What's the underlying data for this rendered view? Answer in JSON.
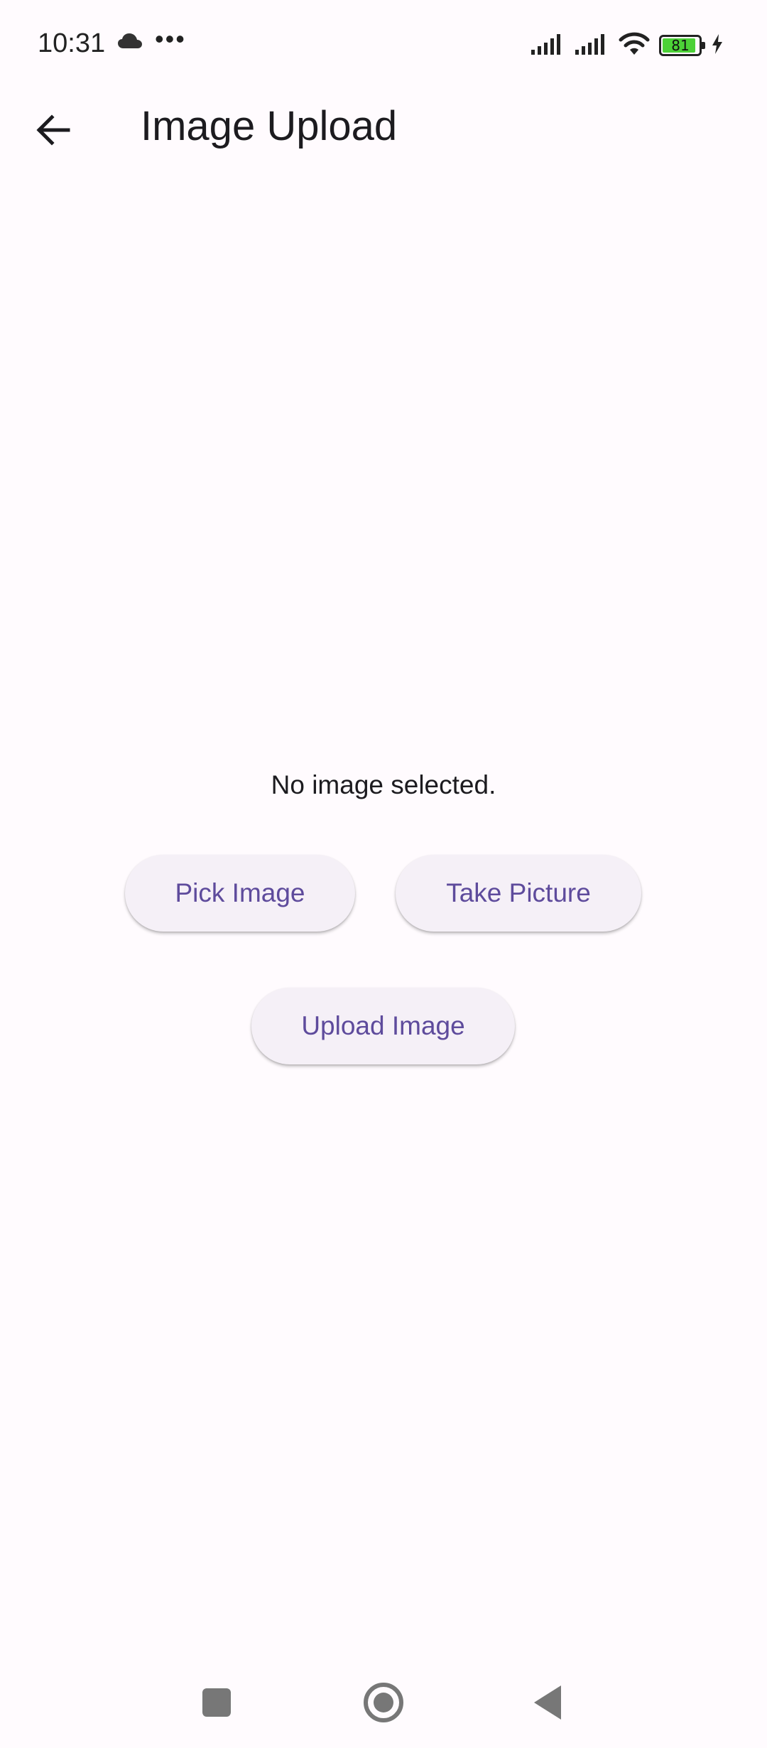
{
  "status_bar": {
    "time": "10:31",
    "notification_icons": [
      "cloud-icon",
      "more-dots-icon"
    ],
    "dots": "•••",
    "system_icons": [
      "signal-icon",
      "signal-icon",
      "wifi-icon",
      "battery-icon",
      "charging-icon"
    ],
    "battery_level": "81"
  },
  "app_bar": {
    "back_icon": "arrow-left-icon",
    "title": "Image Upload"
  },
  "main": {
    "message": "No image selected.",
    "pick_button_label": "Pick Image",
    "take_button_label": "Take Picture",
    "upload_button_label": "Upload Image"
  },
  "nav_bar": {
    "icons": [
      "recents-icon",
      "home-icon",
      "back-icon"
    ]
  },
  "colors": {
    "background": "#fffbfe",
    "button_background": "#f5f0f7",
    "button_text": "#5e4b9c",
    "battery_fill": "#4cd137",
    "nav_icon": "#777777"
  }
}
